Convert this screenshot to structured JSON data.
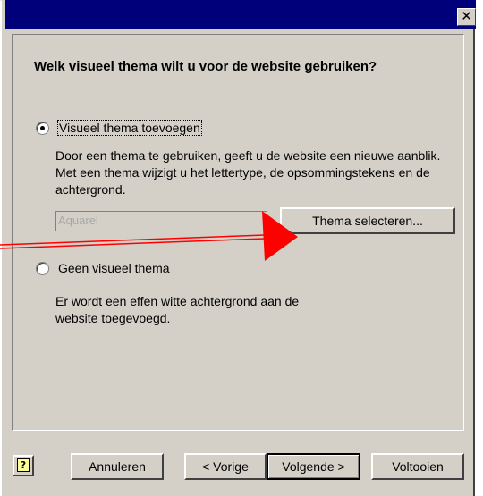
{
  "titlebar": {
    "close_glyph": "✕"
  },
  "dialog": {
    "heading": "Welk visueel thema wilt u voor de website gebruiken?",
    "option1": {
      "label": "Visueel thema toevoegen",
      "checked": true,
      "description": "Door een thema te gebruiken, geeft u de website een nieuwe aanblik. Met een thema wijzigt u het lettertype, de opsommingstekens en de achtergrond."
    },
    "theme_field": {
      "value": "Aquarel"
    },
    "select_theme_button": "Thema selecteren...",
    "option2": {
      "label": "Geen visueel thema",
      "checked": false,
      "description": "Er wordt een effen witte achtergrond aan de website toegevoegd."
    }
  },
  "buttons": {
    "help_icon": "?",
    "cancel": "Annuleren",
    "back": "< Vorige",
    "next": "Volgende >",
    "finish": "Voltooien"
  },
  "annotation": {
    "arrow_color": "#ff0000"
  }
}
